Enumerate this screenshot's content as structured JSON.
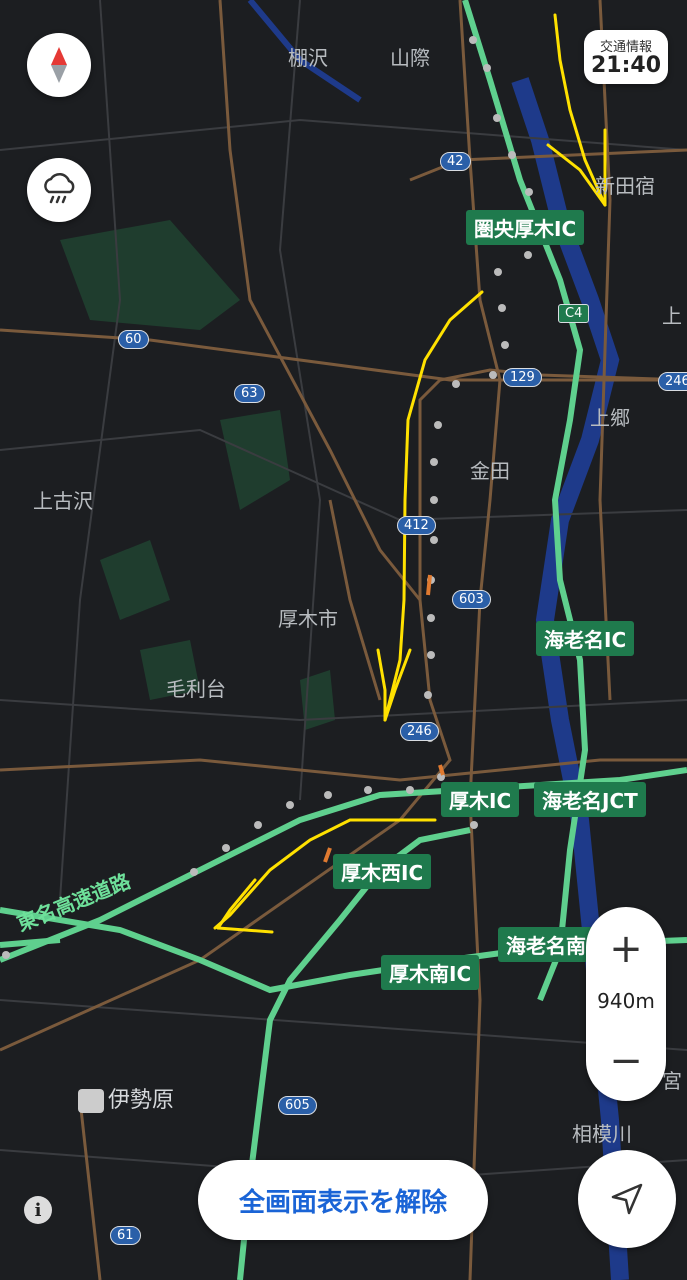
{
  "traffic": {
    "label": "交通情報",
    "time": "21:40"
  },
  "zoom": {
    "scale": "940m",
    "plus": "+",
    "minus": "−"
  },
  "exit_fullscreen": "全画面表示を解除",
  "info": "i",
  "places": {
    "tanasawa": "棚沢",
    "sangiwa": "山際",
    "shindenjuku": "新田宿",
    "kamigo": "上郷",
    "kanada": "金田",
    "kamifurusawa": "上古沢",
    "atsugishi": "厚木市",
    "morinodai": "毛利台",
    "isehara": "伊勢原",
    "sagamigawa": "相模川",
    "kami": "上",
    "miya": "宮"
  },
  "interchanges": {
    "ken_o_atsugi": "圏央厚木IC",
    "ebina_ic": "海老名IC",
    "atsugi_ic": "厚木IC",
    "ebina_jct": "海老名JCT",
    "atsugi_nishi": "厚木西IC",
    "atsugi_minami": "厚木南IC",
    "ebina_minami": "海老名南"
  },
  "expressway": "東名高速道路",
  "shields": {
    "r42": "42",
    "r60": "60",
    "r63": "63",
    "r129": "129",
    "r246a": "246",
    "r412": "412",
    "r603": "603",
    "r246b": "246",
    "r605": "605",
    "r61": "61",
    "c4": "C4"
  },
  "colors": {
    "expressway": "#5fd08e",
    "road": "#7a5a3c",
    "annotation": "#ffe100",
    "river": "#1e3a8a"
  }
}
